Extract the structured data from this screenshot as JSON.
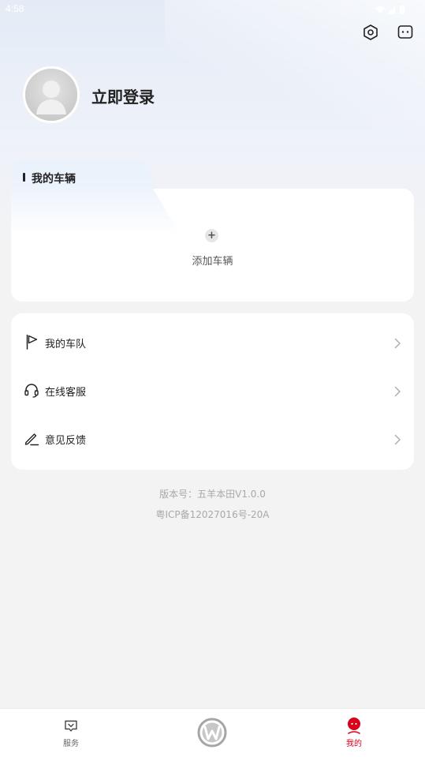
{
  "status_bar": {
    "time": "4:58"
  },
  "header": {
    "settings_icon": "hexagon-settings-icon",
    "message_icon": "message-icon"
  },
  "profile": {
    "login_text": "立即登录"
  },
  "vehicle_section": {
    "title": "我的车辆",
    "add_label": "添加车辆",
    "add_symbol": "+"
  },
  "menu": {
    "items": [
      {
        "label": "我的车队",
        "icon": "flag-icon"
      },
      {
        "label": "在线客服",
        "icon": "headset-icon"
      },
      {
        "label": "意见反馈",
        "icon": "pen-icon"
      }
    ]
  },
  "footer_info": {
    "version": "版本号：五羊本田V1.0.0",
    "icp": "粤ICP备12027016号-20A"
  },
  "bottom_nav": {
    "items": [
      {
        "label": "服务",
        "active": false
      },
      {
        "label": "",
        "active": false
      },
      {
        "label": "我的",
        "active": true
      }
    ]
  },
  "colors": {
    "accent": "#d9001b",
    "background": "#f3f3f4",
    "text_primary": "#222222",
    "text_muted": "#a9a9ab"
  }
}
